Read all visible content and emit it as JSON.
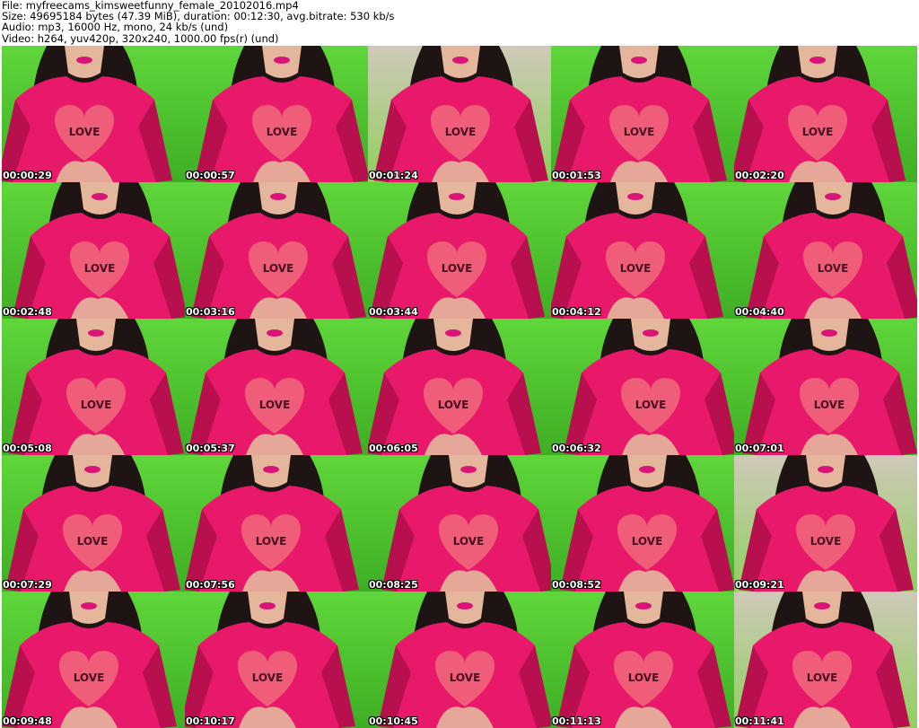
{
  "header": {
    "file": "File: myfreecams_kimsweetfunny_female_20102016.mp4",
    "size": "Size: 49695184 bytes (47.39 MiB), duration: 00:12:30, avg.bitrate: 530 kb/s",
    "audio": "Audio: mp3, 16000 Hz, mono, 24 kb/s (und)",
    "video": "Video: h264, yuv420p, 320x240, 1000.00 fps(r) (und)"
  },
  "thumb_text": "LOVE",
  "colors": {
    "background": "#ffffff",
    "shirt": "#e8196a",
    "shirt_dark": "#b8104f",
    "heart": "#f06a7a",
    "green": "#5fd63a",
    "green_dark": "#3fae24",
    "hair": "#1e1414",
    "skin": "#e4b79c",
    "lips": "#d9157a"
  },
  "thumbnails": [
    {
      "time": "00:00:29",
      "bg": "green"
    },
    {
      "time": "00:00:57",
      "bg": "green"
    },
    {
      "time": "00:01:24",
      "bg": "wall"
    },
    {
      "time": "00:01:53",
      "bg": "green"
    },
    {
      "time": "00:02:20",
      "bg": "green"
    },
    {
      "time": "00:02:48",
      "bg": "green"
    },
    {
      "time": "00:03:16",
      "bg": "green"
    },
    {
      "time": "00:03:44",
      "bg": "green"
    },
    {
      "time": "00:04:12",
      "bg": "green"
    },
    {
      "time": "00:04:40",
      "bg": "green"
    },
    {
      "time": "00:05:08",
      "bg": "green"
    },
    {
      "time": "00:05:37",
      "bg": "green"
    },
    {
      "time": "00:06:05",
      "bg": "green"
    },
    {
      "time": "00:06:32",
      "bg": "green"
    },
    {
      "time": "00:07:01",
      "bg": "green"
    },
    {
      "time": "00:07:29",
      "bg": "green"
    },
    {
      "time": "00:07:56",
      "bg": "green"
    },
    {
      "time": "00:08:25",
      "bg": "green"
    },
    {
      "time": "00:08:52",
      "bg": "green"
    },
    {
      "time": "00:09:21",
      "bg": "wall"
    },
    {
      "time": "00:09:48",
      "bg": "green"
    },
    {
      "time": "00:10:17",
      "bg": "green"
    },
    {
      "time": "00:10:45",
      "bg": "green"
    },
    {
      "time": "00:11:13",
      "bg": "green"
    },
    {
      "time": "00:11:41",
      "bg": "wall"
    }
  ]
}
